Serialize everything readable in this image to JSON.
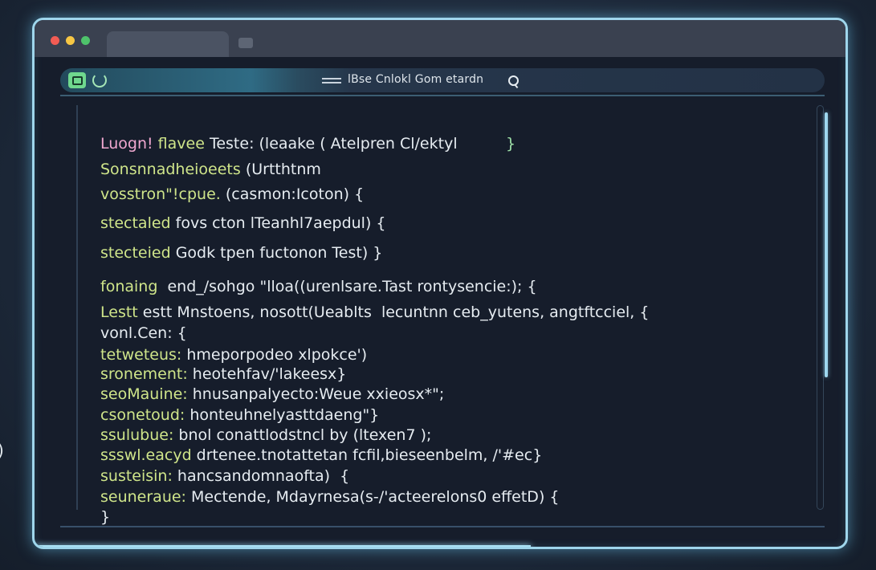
{
  "toolbar": {
    "address_text": "lBse Cnlokl Gom etardn",
    "icons": [
      "window-badge-icon",
      "refresh-icon",
      "menu-icon",
      "search-icon"
    ]
  },
  "side_glyph": ")",
  "code_lines": [
    {
      "a": "Luogn!",
      "b": " flavee",
      "c": " Teste: (leaake ( Atelpren Cl/ektyl",
      "d": "          }"
    },
    {
      "a": "",
      "b": "Sonsnnadheioeets",
      "c": " (Urtthtnm",
      "d": ""
    },
    {
      "a": "",
      "b": "vosstron\"!cpue.",
      "c": " (casmon:Icoton) {",
      "d": ""
    },
    {
      "a": "",
      "b": "stectaled",
      "c": " fovs cton lTeanhl7aepdul) {",
      "d": ""
    },
    {
      "a": "",
      "b": "stecteied",
      "c": " Godk tpen fuctonon Test) }",
      "d": ""
    },
    {
      "a": "",
      "b": "fonaing",
      "c": "  end_/sohgo \"lloa((urenlsare.Tast rontysencie:); {",
      "d": ""
    },
    {
      "a": "",
      "b": "Lestt",
      "c": " estt Mnstoens, nosott(Ueablts  lecuntnn ceb_yutens, angtftcciel, {",
      "d": ""
    },
    {
      "a": "",
      "b": "",
      "c": "vonl.Cen: {",
      "d": ""
    },
    {
      "a": "",
      "b": "tetweteus:",
      "c": " hmeporpodeo xlpokce')",
      "d": ""
    },
    {
      "a": "",
      "b": "sronement:",
      "c": " heotehfav/'lakeesx}",
      "d": ""
    },
    {
      "a": "",
      "b": "seoMauine:",
      "c": " hnusanpalyecto:Weue xxieosx*\";",
      "d": ""
    },
    {
      "a": "",
      "b": "csonetoud:",
      "c": " honteuhnelyasttdaeng\"}",
      "d": ""
    },
    {
      "a": "",
      "b": "ssulubue:",
      "c": " bnol conattlodstncl by (ltexen7 );",
      "d": ""
    },
    {
      "a": "",
      "b": "ssswl.eacyd",
      "c": " drtenee.tnotattetan fcfil,bieseenbelm, /'#ec}",
      "d": ""
    },
    {
      "a": "",
      "b": "susteisin:",
      "c": " hancsandomnaofta)  {",
      "d": ""
    },
    {
      "a": "",
      "b": "seuneraue:",
      "c": " Mectende, Mdayrnesa(s-/'acteerelons0 effetD) {",
      "d": ""
    },
    {
      "a": "",
      "b": "",
      "c": "}",
      "d": ""
    }
  ]
}
